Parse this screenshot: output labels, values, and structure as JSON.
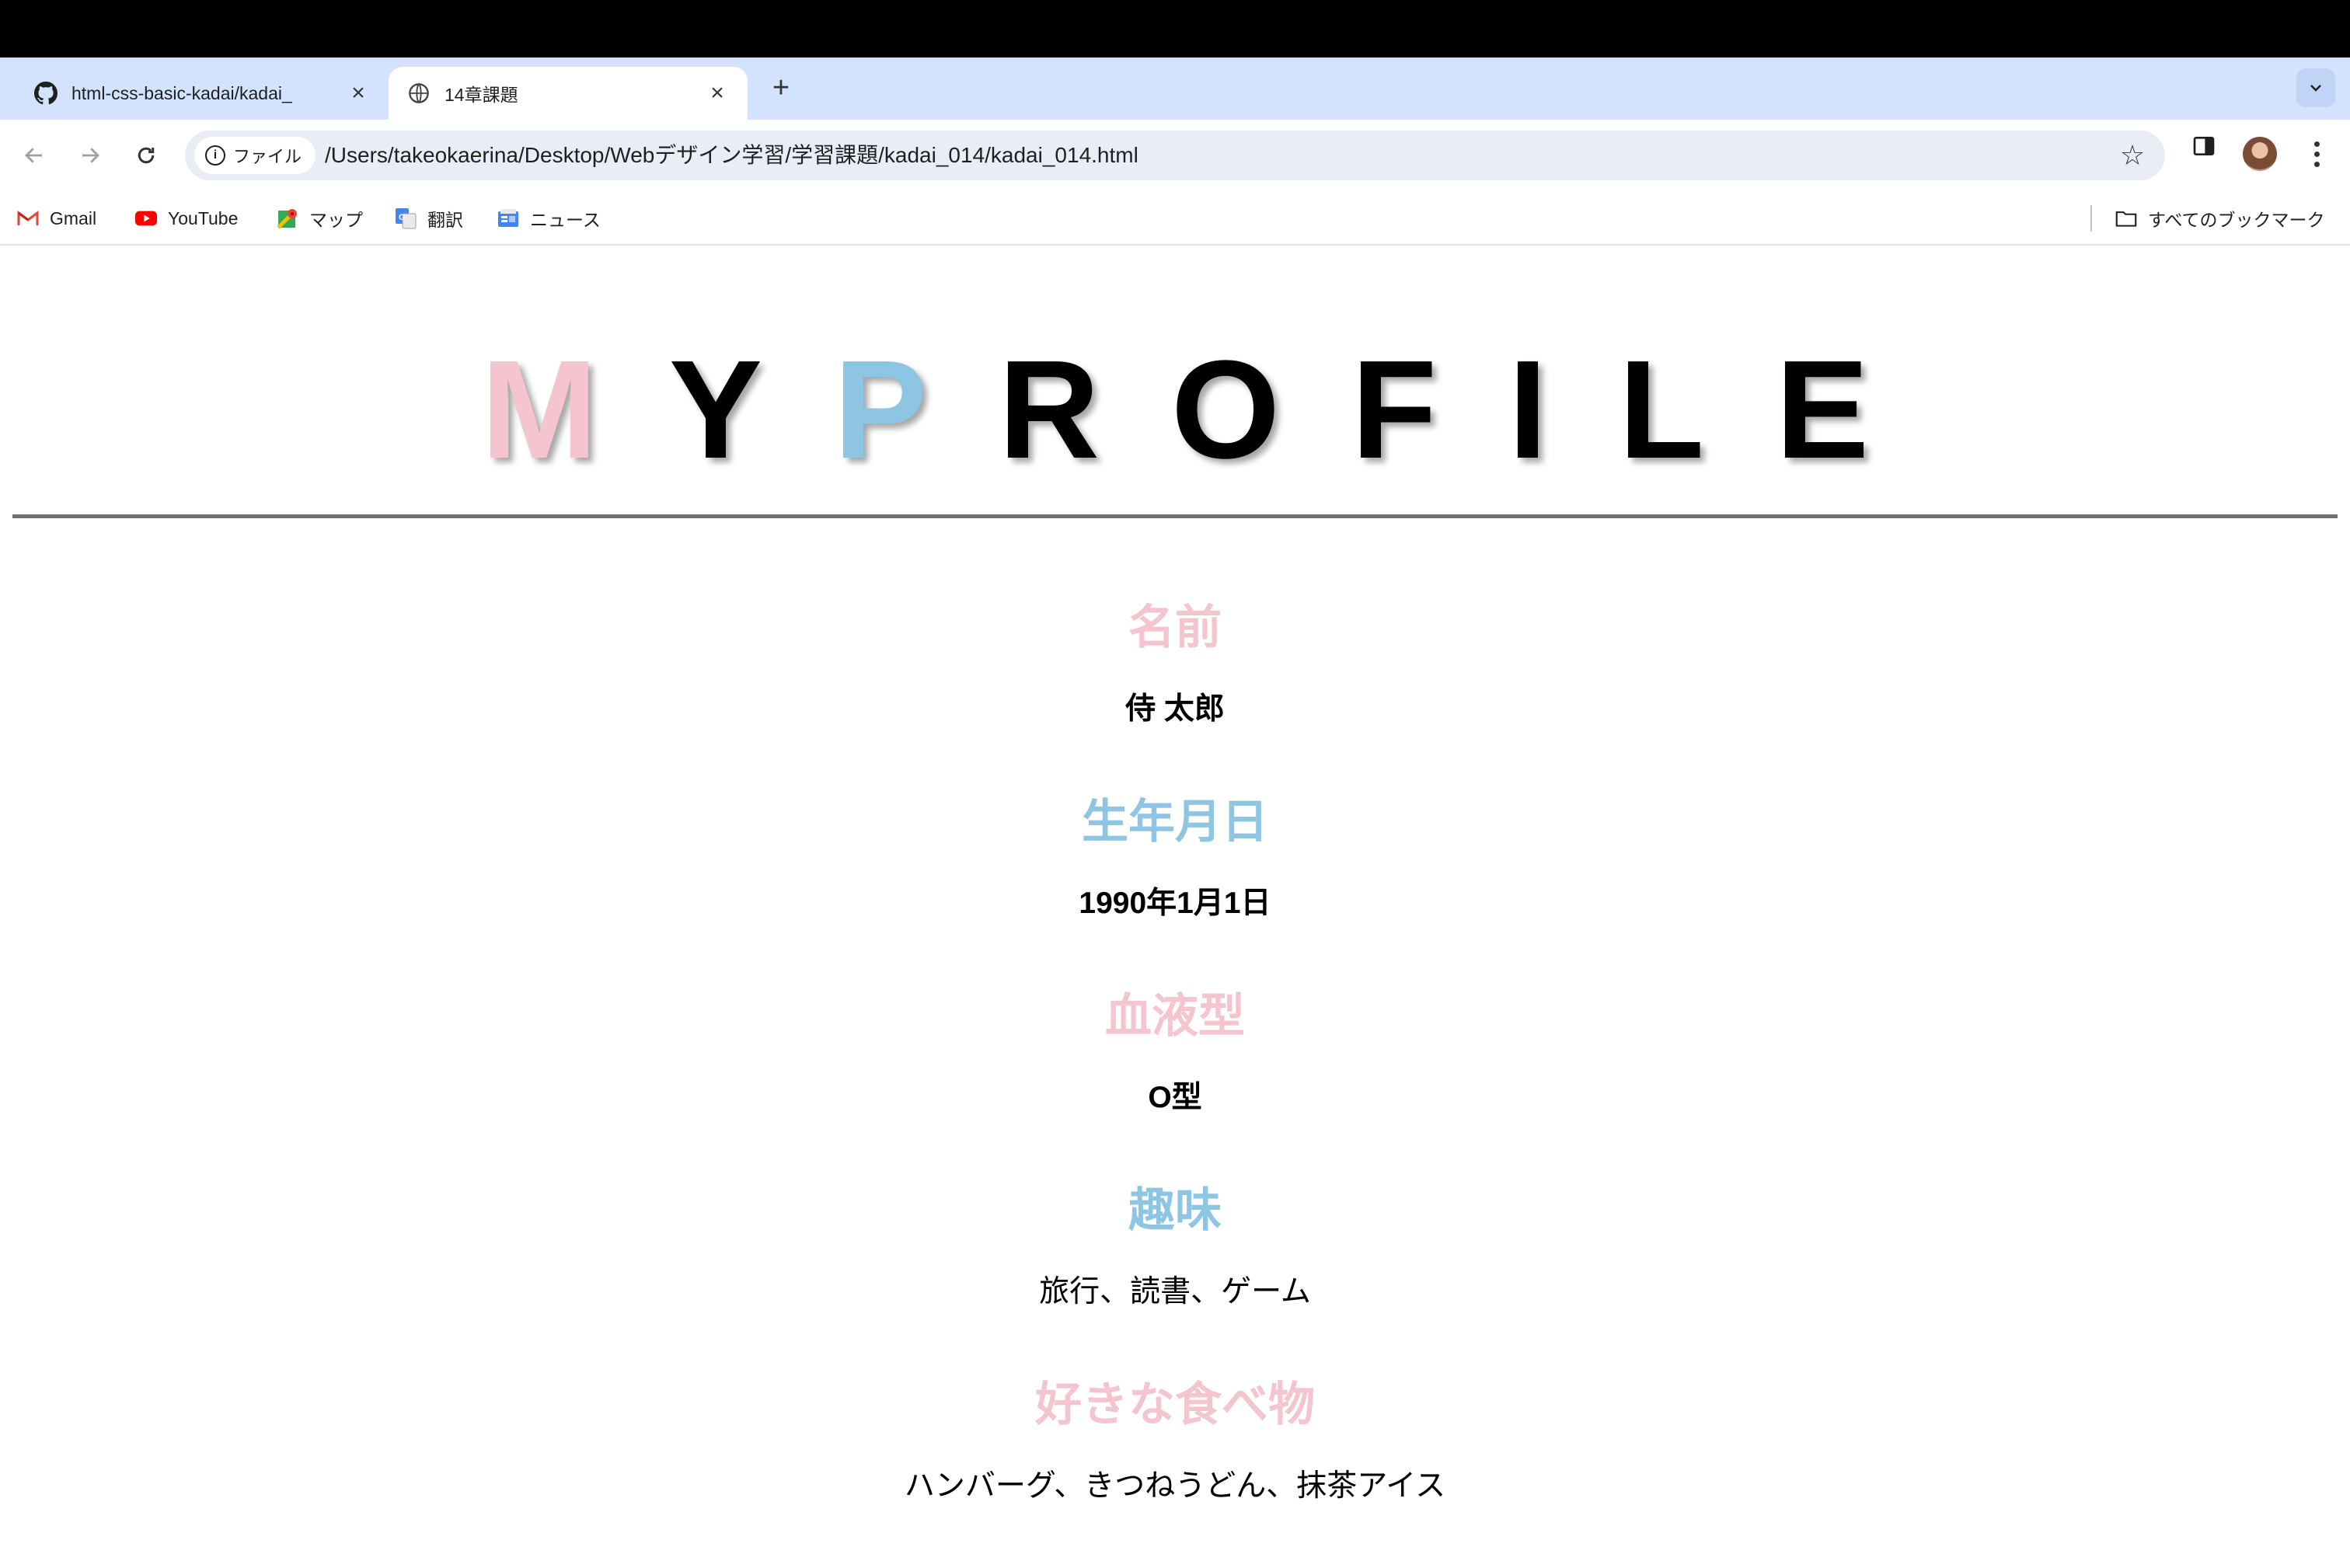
{
  "browser": {
    "tabs": [
      {
        "title": "html-css-basic-kadai/kadai_",
        "favicon": "github-icon",
        "active": false
      },
      {
        "title": "14章課題",
        "favicon": "globe-icon",
        "active": true
      }
    ],
    "omnibox": {
      "chip_label": "ファイル",
      "url": "/Users/takeokaerina/Desktop/Webデザイン学習/学習課題/kadai_014/kadai_014.html"
    },
    "bookmarks": [
      {
        "label": "Gmail",
        "icon": "gmail-icon"
      },
      {
        "label": "YouTube",
        "icon": "youtube-icon"
      },
      {
        "label": "マップ",
        "icon": "maps-icon"
      },
      {
        "label": "翻訳",
        "icon": "translate-icon"
      },
      {
        "label": "ニュース",
        "icon": "news-icon"
      }
    ],
    "all_bookmarks_label": "すべてのブックマーク"
  },
  "page": {
    "headline": [
      "M",
      "Y",
      "P",
      "R",
      "O",
      "F",
      "I",
      "L",
      "E"
    ],
    "colors": {
      "pink": "#f4c4cf",
      "blue": "#8ec5e2",
      "black": "#000000",
      "rule": "#707070"
    },
    "items": [
      {
        "label": "名前",
        "value": "侍 太郎"
      },
      {
        "label": "生年月日",
        "value": "1990年1月1日"
      },
      {
        "label": "血液型",
        "value": "O型"
      },
      {
        "label": "趣味",
        "value": "旅行、読書、ゲーム"
      },
      {
        "label": "好きな食べ物",
        "value": "ハンバーグ、きつねうどん、抹茶アイス"
      }
    ]
  }
}
